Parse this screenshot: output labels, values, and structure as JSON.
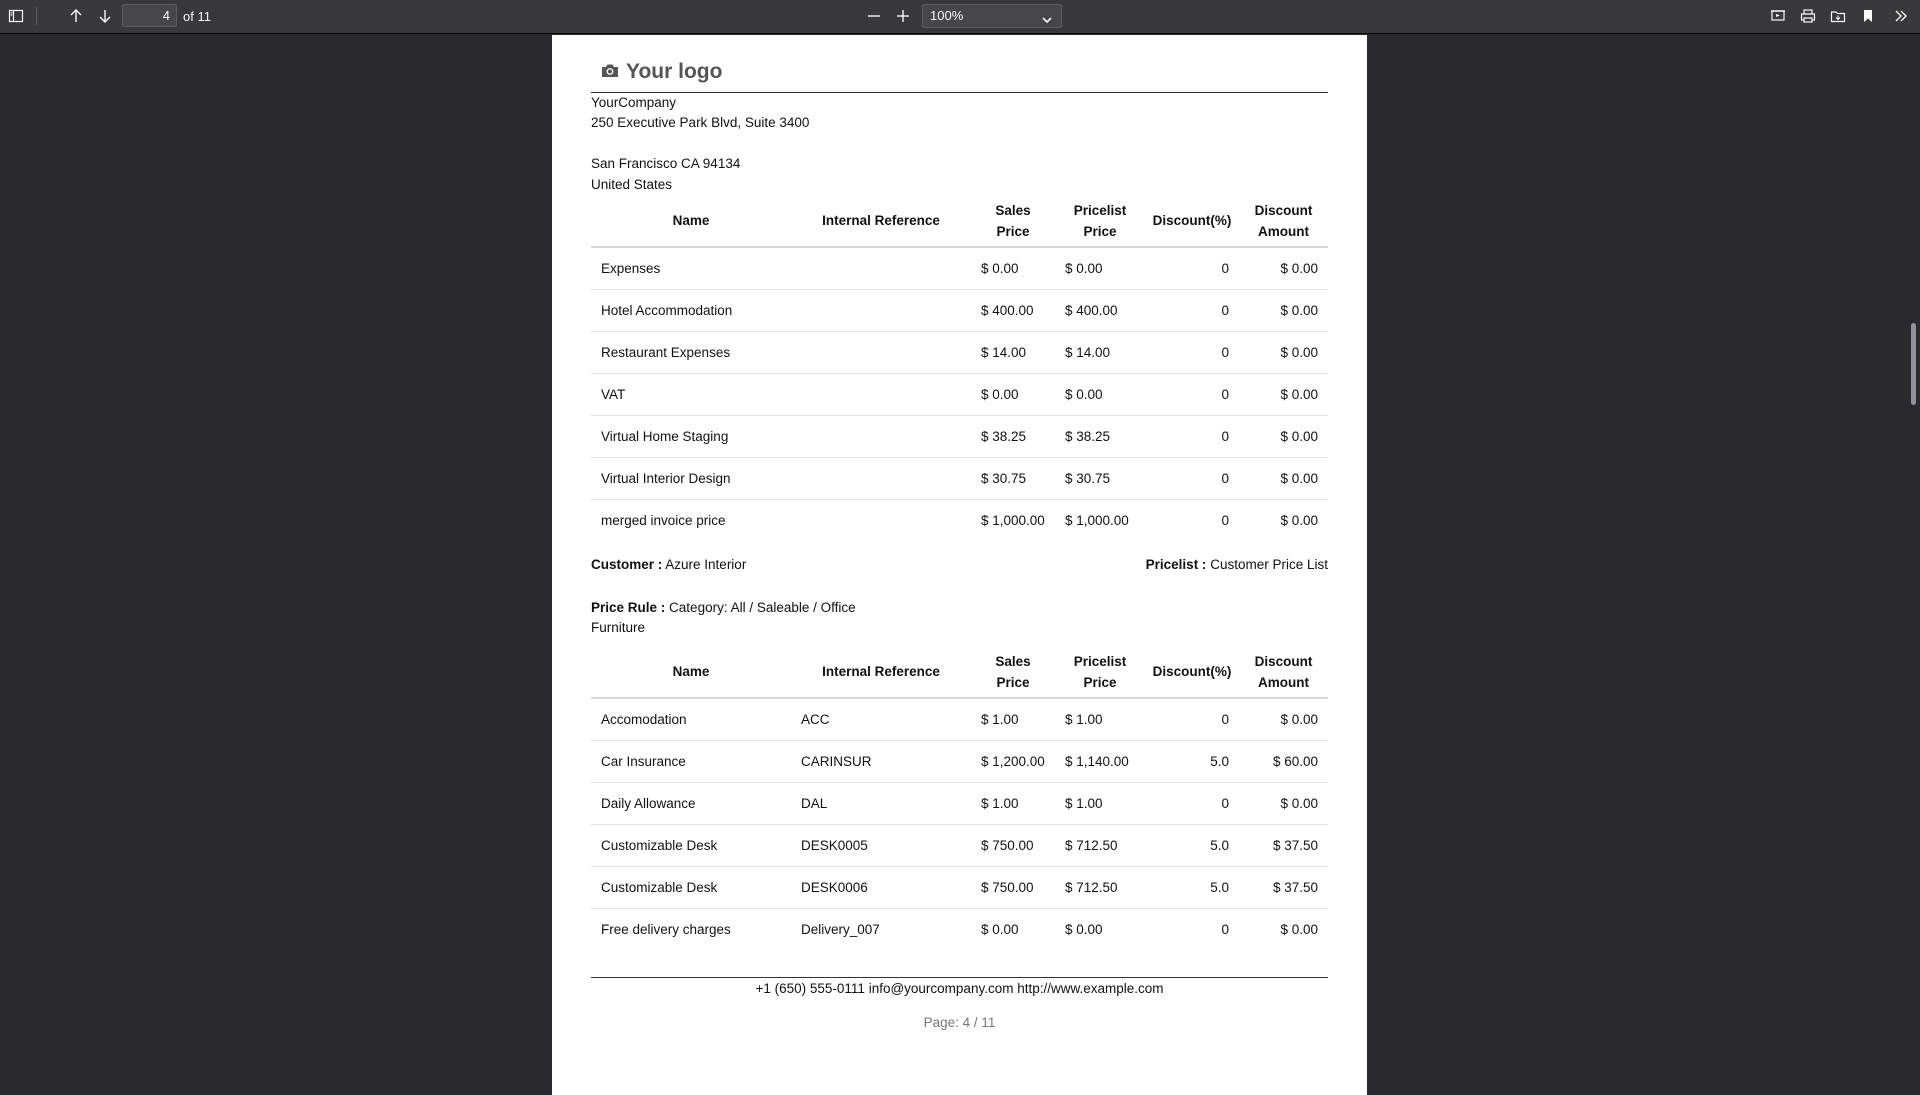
{
  "toolbar": {
    "page_number": "4",
    "page_count": "of 11",
    "zoom": "100%"
  },
  "document": {
    "logo_text": "Your logo",
    "company": {
      "name": "YourCompany",
      "street": "250 Executive Park Blvd, Suite 3400",
      "city": "San Francisco CA 94134",
      "country": "United States"
    },
    "columns": {
      "name": "Name",
      "internal_reference": "Internal Reference",
      "sales_price_1": "Sales",
      "sales_price_2": "Price",
      "pricelist_price_1": "Pricelist",
      "pricelist_price_2": "Price",
      "discount_pct": "Discount(%)",
      "discount_amount_1": "Discount",
      "discount_amount_2": "Amount"
    },
    "table1_rows": [
      {
        "name": "Expenses",
        "ref": "",
        "sales": "$ 0.00",
        "pricelist": "$ 0.00",
        "disc": "0",
        "amount": "$ 0.00"
      },
      {
        "name": "Hotel Accommodation",
        "ref": "",
        "sales": "$ 400.00",
        "pricelist": "$ 400.00",
        "disc": "0",
        "amount": "$ 0.00"
      },
      {
        "name": "Restaurant Expenses",
        "ref": "",
        "sales": "$ 14.00",
        "pricelist": "$ 14.00",
        "disc": "0",
        "amount": "$ 0.00"
      },
      {
        "name": "VAT",
        "ref": "",
        "sales": "$ 0.00",
        "pricelist": "$ 0.00",
        "disc": "0",
        "amount": "$ 0.00"
      },
      {
        "name": "Virtual Home Staging",
        "ref": "",
        "sales": "$ 38.25",
        "pricelist": "$ 38.25",
        "disc": "0",
        "amount": "$ 0.00"
      },
      {
        "name": "Virtual Interior Design",
        "ref": "",
        "sales": "$ 30.75",
        "pricelist": "$ 30.75",
        "disc": "0",
        "amount": "$ 0.00"
      },
      {
        "name": "merged invoice price",
        "ref": "",
        "sales": "$ 1,000.00",
        "pricelist": "$ 1,000.00",
        "disc": "0",
        "amount": "$ 0.00"
      }
    ],
    "customer_label": "Customer :",
    "customer_value": "Azure Interior",
    "pricelist_label": "Pricelist :",
    "pricelist_value": "Customer Price List",
    "price_rule_label": "Price Rule :",
    "price_rule_value_1": "Category: All / Saleable / Office",
    "price_rule_value_2": "Furniture",
    "table2_rows": [
      {
        "name": "Accomodation",
        "ref": "ACC",
        "sales": "$ 1.00",
        "pricelist": "$ 1.00",
        "disc": "0",
        "amount": "$ 0.00"
      },
      {
        "name": "Car Insurance",
        "ref": "CARINSUR",
        "sales": "$ 1,200.00",
        "pricelist": "$ 1,140.00",
        "disc": "5.0",
        "amount": "$ 60.00"
      },
      {
        "name": "Daily Allowance",
        "ref": "DAL",
        "sales": "$ 1.00",
        "pricelist": "$ 1.00",
        "disc": "0",
        "amount": "$ 0.00"
      },
      {
        "name": "Customizable Desk",
        "ref": "DESK0005",
        "sales": "$ 750.00",
        "pricelist": "$ 712.50",
        "disc": "5.0",
        "amount": "$ 37.50"
      },
      {
        "name": "Customizable Desk",
        "ref": "DESK0006",
        "sales": "$ 750.00",
        "pricelist": "$ 712.50",
        "disc": "5.0",
        "amount": "$ 37.50"
      },
      {
        "name": "Free delivery charges",
        "ref": "Delivery_007",
        "sales": "$ 0.00",
        "pricelist": "$ 0.00",
        "disc": "0",
        "amount": "$ 0.00"
      }
    ],
    "footer_contact": "+1 (650) 555-0111 info@yourcompany.com http://www.example.com",
    "footer_page": "Page: 4 / 11"
  }
}
